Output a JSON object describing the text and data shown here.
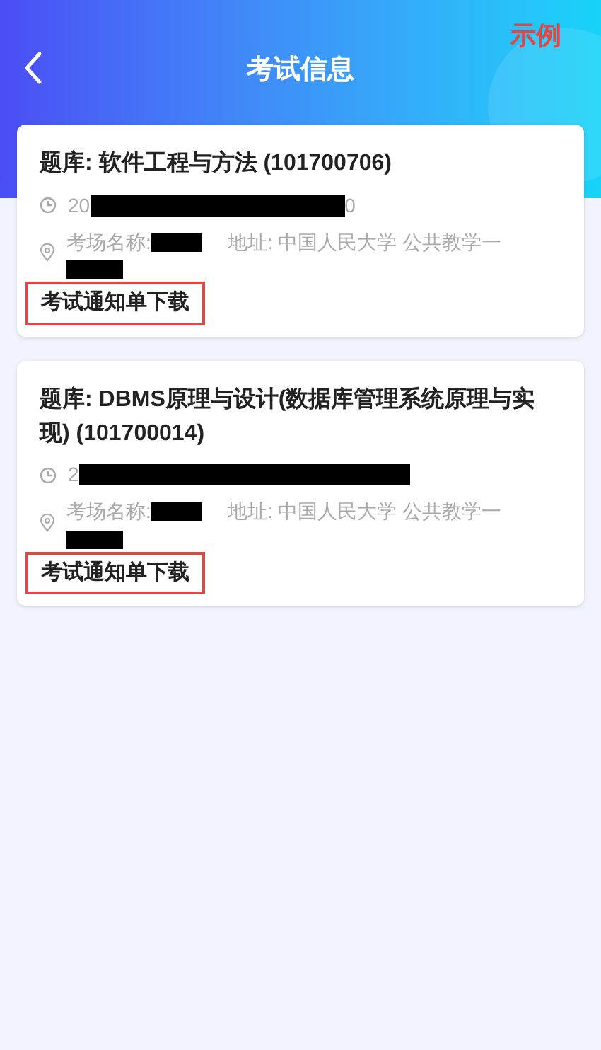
{
  "header": {
    "title": "考试信息",
    "watermark_label": "示例"
  },
  "exams": [
    {
      "title": "题库: 软件工程与方法 (101700706)",
      "time": [
        {
          "kind": "text",
          "text": "20"
        },
        {
          "kind": "redacted-long"
        },
        {
          "kind": "text",
          "text": "0"
        }
      ],
      "venue_label": "考场名称:",
      "address": "地址: 中国人民大学 公共教学一",
      "download": "考试通知单下载",
      "highlighted": true
    },
    {
      "title": "题库: DBMS原理与设计(数据库管理系统原理与实现) (101700014)",
      "time": [
        {
          "kind": "text",
          "text": "2"
        },
        {
          "kind": "redacted-longer"
        }
      ],
      "venue_label": "考场名称:",
      "address": "地址: 中国人民大学 公共教学一",
      "download": "考试通知单下载",
      "highlighted": true
    }
  ]
}
